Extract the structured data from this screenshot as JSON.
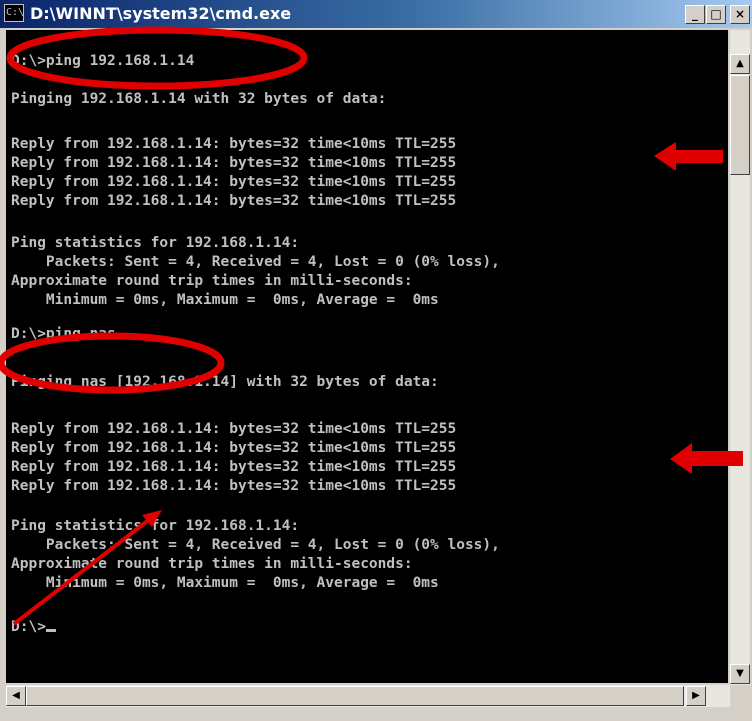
{
  "window": {
    "title": "D:\\WINNT\\system32\\cmd.exe",
    "icon_label": "C:\\",
    "controls": {
      "minimize": "_",
      "maximize": "□",
      "close": "×"
    }
  },
  "console": {
    "lines": [
      "D:\\>ping 192.168.1.14",
      "",
      "Pinging 192.168.1.14 with 32 bytes of data:",
      "",
      "Reply from 192.168.1.14: bytes=32 time<10ms TTL=255",
      "Reply from 192.168.1.14: bytes=32 time<10ms TTL=255",
      "Reply from 192.168.1.14: bytes=32 time<10ms TTL=255",
      "Reply from 192.168.1.14: bytes=32 time<10ms TTL=255",
      "",
      "Ping statistics for 192.168.1.14:",
      "    Packets: Sent = 4, Received = 4, Lost = 0 (0% loss),",
      "Approximate round trip times in milli-seconds:",
      "    Minimum = 0ms, Maximum =  0ms, Average =  0ms",
      "",
      "D:\\>ping nas",
      "",
      "Pinging nas [192.168.1.14] with 32 bytes of data:",
      "",
      "Reply from 192.168.1.14: bytes=32 time<10ms TTL=255",
      "Reply from 192.168.1.14: bytes=32 time<10ms TTL=255",
      "Reply from 192.168.1.14: bytes=32 time<10ms TTL=255",
      "Reply from 192.168.1.14: bytes=32 time<10ms TTL=255",
      "",
      "Ping statistics for 192.168.1.14:",
      "    Packets: Sent = 4, Received = 4, Lost = 0 (0% loss),",
      "Approximate round trip times in milli-seconds:",
      "    Minimum = 0ms, Maximum =  0ms, Average =  0ms",
      "",
      "D:\\>"
    ]
  },
  "scrollbars": {
    "up": "▲",
    "down": "▼",
    "left": "◀",
    "right": "▶"
  },
  "colors": {
    "console_bg": "#000000",
    "console_text": "#c0c0c0",
    "annotation": "#e00000"
  },
  "annotations": {
    "icons": [
      "circle-highlight",
      "circle-highlight",
      "arrow-left",
      "arrow-left",
      "arrow-pointer"
    ]
  }
}
